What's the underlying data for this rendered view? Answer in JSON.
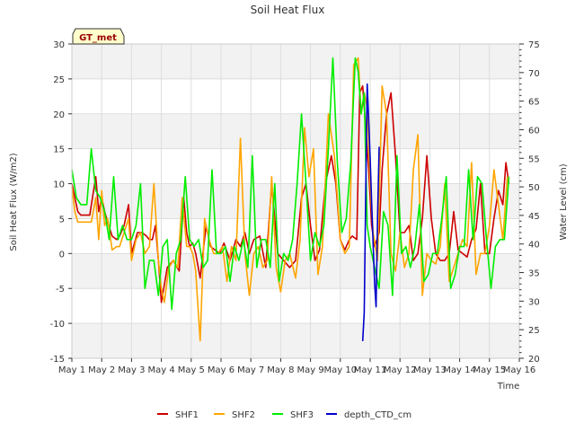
{
  "chart_data": {
    "type": "line",
    "title": "Soil Heat Flux",
    "xlabel": "Time",
    "ylabel": "Soil Heat Flux (W/m2)",
    "y2label": "Water Level (cm)",
    "badge": "GT_met",
    "xlim": [
      0,
      15
    ],
    "ylim": [
      -15,
      30
    ],
    "y2lim": [
      20,
      75
    ],
    "x_ticks": [
      0,
      1,
      2,
      3,
      4,
      5,
      6,
      7,
      8,
      9,
      10,
      11,
      12,
      13,
      14,
      15
    ],
    "x_tick_labels": [
      "May 1",
      "May 2",
      "May 3",
      "May 4",
      "May 5",
      "May 6",
      "May 7",
      "May 8",
      "May 9",
      "May 10",
      "May 11",
      "May 12",
      "May 13",
      "May 14",
      "May 15",
      "May 16"
    ],
    "y_ticks": [
      -15,
      -10,
      -5,
      0,
      5,
      10,
      15,
      20,
      25,
      30
    ],
    "y2_ticks": [
      20,
      25,
      30,
      35,
      40,
      45,
      50,
      55,
      60,
      65,
      70,
      75
    ],
    "grid": true,
    "legend_position": "bottom",
    "colors": {
      "SHF1": "#cc0000",
      "SHF2": "#ffa500",
      "SHF3": "#00ee00",
      "depth_CTD_cm": "#0000cc",
      "band": "#f2f2f2",
      "grid": "#dddddd"
    },
    "series": [
      {
        "name": "SHF1",
        "axis": "left",
        "x": [
          0.0,
          0.1,
          0.2,
          0.3,
          0.45,
          0.6,
          0.8,
          0.9,
          1.0,
          1.1,
          1.2,
          1.35,
          1.5,
          1.6,
          1.75,
          1.9,
          2.0,
          2.2,
          2.35,
          2.5,
          2.6,
          2.7,
          2.8,
          2.9,
          3.0,
          3.2,
          3.4,
          3.6,
          3.75,
          3.85,
          3.95,
          4.05,
          4.15,
          4.3,
          4.5,
          4.65,
          4.8,
          4.95,
          5.1,
          5.3,
          5.5,
          5.65,
          5.8,
          5.95,
          6.1,
          6.3,
          6.5,
          6.7,
          6.9,
          7.1,
          7.3,
          7.5,
          7.7,
          7.85,
          8.0,
          8.15,
          8.3,
          8.5,
          8.7,
          8.85,
          9.0,
          9.15,
          9.3,
          9.4,
          9.55,
          9.65,
          9.75,
          9.85,
          9.95,
          10.05,
          10.15,
          10.3,
          10.4,
          10.55,
          10.7,
          10.85,
          11.0,
          11.15,
          11.3,
          11.45,
          11.6,
          11.75,
          11.9,
          12.05,
          12.2,
          12.35,
          12.5,
          12.65,
          12.8,
          12.95,
          13.1,
          13.25,
          13.4,
          13.55,
          13.7,
          13.85,
          14.0,
          14.15,
          14.3,
          14.45,
          14.55,
          14.65
        ],
        "y": [
          10,
          8,
          6,
          5.5,
          5.5,
          5.5,
          11,
          6,
          8,
          6,
          4.5,
          2.5,
          2,
          2.5,
          4,
          7,
          0,
          3,
          3,
          2.5,
          2,
          2,
          4,
          -1,
          -7,
          -2,
          -1,
          -2.5,
          8,
          3,
          1,
          1.5,
          0,
          -3.5,
          4,
          1,
          0.5,
          0,
          1.5,
          -1,
          2,
          1,
          3,
          0,
          2,
          2.5,
          -2,
          10,
          0,
          -1,
          -2,
          -1,
          8,
          10,
          4,
          -1,
          0.5,
          10,
          14,
          10,
          2,
          0.5,
          2,
          2.5,
          2,
          23,
          24,
          18,
          12,
          4,
          1,
          3,
          12,
          20,
          23,
          14,
          3,
          3,
          4,
          -1,
          0,
          5,
          14,
          5,
          0,
          -1,
          -1,
          0,
          6,
          0.5,
          0,
          -0.5,
          2,
          3.5,
          10,
          0,
          0,
          5,
          9,
          7,
          13,
          10
        ]
      },
      {
        "name": "SHF2",
        "axis": "left",
        "x": [
          0.0,
          0.1,
          0.2,
          0.35,
          0.5,
          0.65,
          0.8,
          0.9,
          1.0,
          1.1,
          1.2,
          1.35,
          1.5,
          1.6,
          1.75,
          1.9,
          2.0,
          2.15,
          2.3,
          2.45,
          2.6,
          2.75,
          2.9,
          3.0,
          3.1,
          3.25,
          3.4,
          3.55,
          3.7,
          3.85,
          3.95,
          4.05,
          4.15,
          4.3,
          4.45,
          4.6,
          4.75,
          4.9,
          5.05,
          5.2,
          5.35,
          5.5,
          5.65,
          5.8,
          5.95,
          6.1,
          6.25,
          6.4,
          6.55,
          6.7,
          6.85,
          7.0,
          7.15,
          7.3,
          7.5,
          7.65,
          7.8,
          7.95,
          8.1,
          8.25,
          8.4,
          8.6,
          8.8,
          9.0,
          9.15,
          9.3,
          9.45,
          9.6,
          9.7,
          9.8,
          9.9,
          10.0,
          10.1,
          10.25,
          10.4,
          10.55,
          10.7,
          10.85,
          11.0,
          11.15,
          11.3,
          11.45,
          11.6,
          11.75,
          11.9,
          12.05,
          12.2,
          12.35,
          12.5,
          12.65,
          12.8,
          12.95,
          13.1,
          13.25,
          13.4,
          13.55,
          13.7,
          13.85,
          14.0,
          14.15,
          14.3,
          14.45,
          14.6
        ],
        "y": [
          9.5,
          6,
          4.5,
          4.5,
          4.5,
          4.5,
          8,
          2,
          9,
          4,
          5,
          0.5,
          1,
          1,
          3,
          5,
          -1,
          2,
          3,
          0,
          1,
          10,
          -1,
          -5,
          -7,
          -2,
          -1,
          -2,
          8,
          1,
          1,
          0,
          -2.5,
          -12.5,
          5,
          2,
          0,
          0,
          1,
          -4,
          1,
          -1,
          16.5,
          0,
          -6,
          0,
          1,
          -2,
          -1,
          11,
          -2,
          -5.5,
          -1,
          0,
          -3.5,
          2,
          18,
          11,
          15,
          -3,
          1,
          20,
          14,
          2,
          0,
          1,
          27,
          28,
          20,
          23,
          21,
          10,
          3,
          -1,
          24,
          20,
          0,
          -2.5,
          3,
          -2,
          0,
          12,
          17,
          -6,
          0,
          -1,
          -1.5,
          1,
          10,
          -4,
          -2,
          0,
          2,
          1,
          13,
          -3,
          0,
          0,
          4,
          12,
          7,
          2,
          11
        ]
      },
      {
        "name": "SHF3",
        "axis": "left",
        "x": [
          0.0,
          0.15,
          0.3,
          0.5,
          0.65,
          0.8,
          0.95,
          1.1,
          1.25,
          1.4,
          1.55,
          1.7,
          1.85,
          2.0,
          2.15,
          2.3,
          2.45,
          2.6,
          2.75,
          2.9,
          3.05,
          3.2,
          3.35,
          3.5,
          3.65,
          3.8,
          3.95,
          4.1,
          4.25,
          4.4,
          4.55,
          4.7,
          4.85,
          5.0,
          5.15,
          5.3,
          5.45,
          5.6,
          5.75,
          5.9,
          6.05,
          6.2,
          6.35,
          6.5,
          6.65,
          6.8,
          6.95,
          7.1,
          7.25,
          7.4,
          7.55,
          7.7,
          7.85,
          8.0,
          8.15,
          8.3,
          8.45,
          8.6,
          8.75,
          8.9,
          9.05,
          9.2,
          9.35,
          9.5,
          9.6,
          9.7,
          9.8,
          9.9,
          10.0,
          10.15,
          10.3,
          10.45,
          10.6,
          10.75,
          10.9,
          11.05,
          11.2,
          11.35,
          11.5,
          11.65,
          11.8,
          11.95,
          12.1,
          12.25,
          12.4,
          12.55,
          12.7,
          12.85,
          13.0,
          13.15,
          13.3,
          13.45,
          13.6,
          13.75,
          13.9,
          14.05,
          14.2,
          14.35,
          14.5,
          14.65
        ],
        "y": [
          12,
          8,
          7,
          7,
          15,
          9,
          8,
          6,
          2,
          11,
          2,
          4,
          2,
          2,
          4,
          10,
          -5,
          -1,
          -1,
          -6,
          1,
          2,
          -8,
          0,
          2,
          11,
          2,
          1,
          2,
          -2,
          -1,
          12,
          0,
          0,
          1,
          -4,
          1,
          -1,
          2,
          -2,
          14,
          -2,
          2,
          2,
          -2,
          10,
          -4,
          0,
          -1,
          2,
          10,
          20,
          10,
          -1,
          3,
          1,
          4,
          15,
          28,
          13,
          3,
          5,
          13,
          28,
          26,
          20,
          23,
          4,
          1,
          -2,
          -5,
          6,
          4,
          -6,
          14,
          0,
          1,
          -2,
          1,
          7,
          -4,
          -3,
          0,
          0,
          5,
          11,
          -5,
          -3,
          1,
          1,
          12,
          2,
          11,
          10,
          2,
          -5,
          1,
          2,
          2,
          11
        ]
      },
      {
        "name": "depth_CTD_cm",
        "axis": "right",
        "x": [
          9.75,
          9.8,
          9.85,
          9.9,
          9.95,
          10.0,
          10.05,
          10.1,
          10.15,
          10.2,
          10.25,
          10.3
        ],
        "y": [
          23,
          28,
          48,
          68,
          62,
          55,
          47,
          40,
          33,
          29,
          45,
          57
        ]
      }
    ]
  }
}
